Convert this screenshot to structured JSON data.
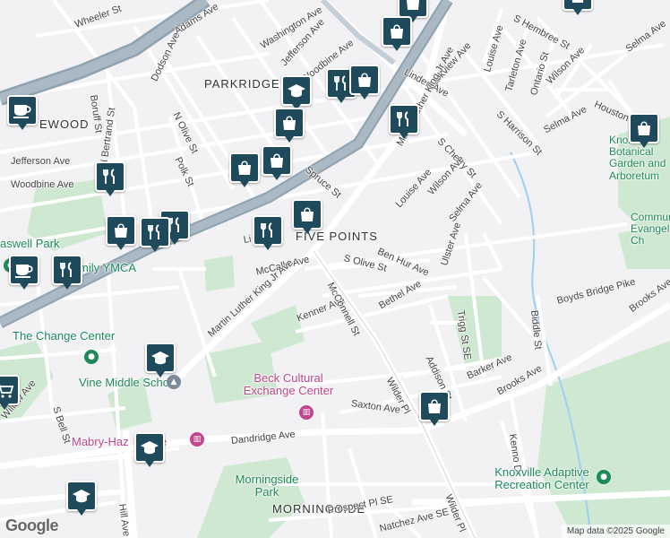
{
  "neighborhoods": [
    "PARKRIDGE",
    "EWOOD",
    "FIVE POINTS",
    "MORNINGSIDE"
  ],
  "streets": [
    "Wheeler St",
    "Adams Ave",
    "Washington Ave",
    "Jefferson Ave",
    "Woodbine Ave",
    "Dodson Ave",
    "N Olive St",
    "Boruff St",
    "N Bertrand St",
    "Jefferson Ave",
    "Woodbine Ave",
    "Polk St",
    "Spruce St",
    "Linden Ave",
    "Parkview Ave",
    "Martin Luther King Jr Ave",
    "S Cherry St",
    "Louise Ave",
    "Wilson Ave",
    "Selma Ave",
    "Ulster Ave",
    "Ben Hur Ave",
    "S Olive St",
    "McCalla Ave",
    "Martin Luther King Jr Ave",
    "Kenner Ave",
    "Bethel Ave",
    "McConnell St",
    "Trigg St SE",
    "Addison St",
    "Barker Ave",
    "Brooks Ave",
    "Saxton Ave",
    "Wilder Pl",
    "Dandridge Ave",
    "Willow Ave",
    "S Bell St",
    "Hill Ave",
    "Prospect Pl SE",
    "Natchez Ave SE",
    "Wilder Pl",
    "Kenno Dr",
    "Biddle St",
    "Boyds Bridge Pike",
    "Brooks Ave",
    "S Hembree St",
    "Louise Ave",
    "Tarleton Ave",
    "Ontario St",
    "Wilson Ave",
    "S Harrison St",
    "Selma Ave",
    "Houston",
    "Selma Ave",
    "Linden Ave",
    "Li"
  ],
  "pois": {
    "knoxville_botanical": "Knoxville Botanical Garden and Arboretum",
    "community_evangelistic": "Community Evangelistic Ch",
    "caswell_park": "aswell Park",
    "ymca": "mily YMCA",
    "the_change_center": "The Change Center",
    "vine_middle_school": "Vine Middle School",
    "beck_cultural": "Beck Cultural Exchange Center",
    "mabry_hazen": "Mabry-Haz    ouse",
    "morningside_park": "Morningside Park",
    "adaptive_rec": "Knoxville Adaptive Recreation Center"
  },
  "markers": [
    {
      "icon": "shopping-bag-icon"
    },
    {
      "icon": "shopping-bag-icon"
    },
    {
      "icon": "shopping-bag-icon"
    },
    {
      "icon": "graduation-cap-icon"
    },
    {
      "icon": "restaurant-icon"
    },
    {
      "icon": "shopping-bag-icon"
    },
    {
      "icon": "shopping-bag-icon"
    },
    {
      "icon": "shopping-bag-icon"
    },
    {
      "icon": "shopping-bag-icon"
    },
    {
      "icon": "restaurant-icon"
    },
    {
      "icon": "coffee-icon"
    },
    {
      "icon": "restaurant-icon"
    },
    {
      "icon": "shopping-bag-icon"
    },
    {
      "icon": "restaurant-icon"
    },
    {
      "icon": "restaurant-icon"
    },
    {
      "icon": "shopping-bag-icon"
    },
    {
      "icon": "restaurant-icon"
    },
    {
      "icon": "coffee-icon"
    },
    {
      "icon": "restaurant-icon"
    },
    {
      "icon": "graduation-cap-icon"
    },
    {
      "icon": "graduation-cap-icon"
    },
    {
      "icon": "graduation-cap-icon"
    },
    {
      "icon": "shopping-cart-icon"
    },
    {
      "icon": "shopping-bag-icon"
    },
    {
      "icon": "shopping-bag-icon"
    }
  ],
  "attribution": "Map data ©2025 Google",
  "logo": "Google"
}
